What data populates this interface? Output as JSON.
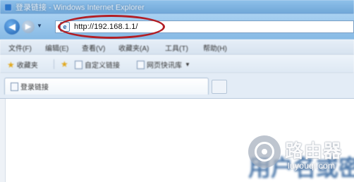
{
  "window": {
    "title": "登录链接 - Windows Internet Explorer"
  },
  "address_bar": {
    "url": "http://192.168.1.1/",
    "page_icon_glyph": "e",
    "highlight_color": "#b21e24"
  },
  "nav": {
    "back_glyph": "◀",
    "forward_glyph": "▶",
    "dropdown_glyph": "▼"
  },
  "menu": {
    "items": [
      "文件(F)",
      "编辑(E)",
      "查看(V)",
      "收藏夹(A)",
      "工具(T)",
      "帮助(H)"
    ]
  },
  "favorites_bar": {
    "favorites_label": "收藏夹",
    "items": [
      "自定义链接",
      "网页快讯库"
    ],
    "dropdown_glyph": "▼"
  },
  "tabs": [
    {
      "label": "登录链接",
      "active": true
    }
  ],
  "page": {
    "heading_fragment": "用户名或密"
  },
  "watermark": {
    "title": "路由器",
    "subtitle": "luyouqi.com"
  }
}
